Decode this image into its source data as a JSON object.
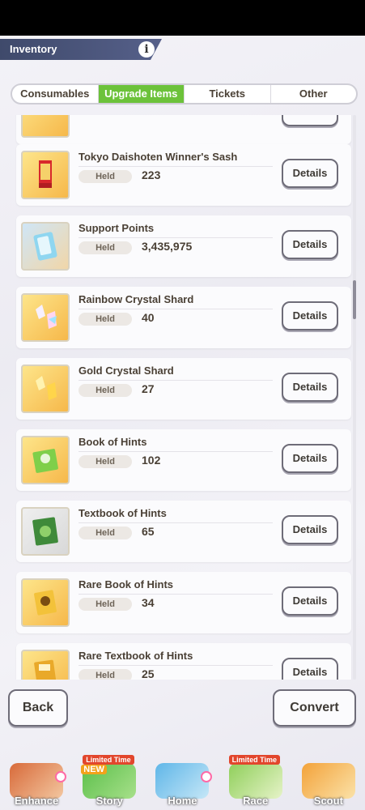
{
  "header": {
    "title": "Inventory",
    "info_glyph": "i"
  },
  "tabs": [
    {
      "label": "Consumables",
      "active": false
    },
    {
      "label": "Upgrade Items",
      "active": true
    },
    {
      "label": "Tickets",
      "active": false
    },
    {
      "label": "Other",
      "active": false
    }
  ],
  "items": [
    {
      "name": "Tokyo Daishoten Winner's Sash",
      "held_label": "Held",
      "count": "223",
      "details_label": "Details",
      "icon": "sash-icon"
    },
    {
      "name": "Support Points",
      "held_label": "Held",
      "count": "3,435,975",
      "details_label": "Details",
      "icon": "support-card-icon"
    },
    {
      "name": "Rainbow Crystal Shard",
      "held_label": "Held",
      "count": "40",
      "details_label": "Details",
      "icon": "rainbow-shard-icon"
    },
    {
      "name": "Gold Crystal Shard",
      "held_label": "Held",
      "count": "27",
      "details_label": "Details",
      "icon": "gold-shard-icon"
    },
    {
      "name": "Book of Hints",
      "held_label": "Held",
      "count": "102",
      "details_label": "Details",
      "icon": "book-of-hints-icon"
    },
    {
      "name": "Textbook of Hints",
      "held_label": "Held",
      "count": "65",
      "details_label": "Details",
      "icon": "textbook-of-hints-icon"
    },
    {
      "name": "Rare Book of Hints",
      "held_label": "Held",
      "count": "34",
      "details_label": "Details",
      "icon": "rare-book-icon"
    },
    {
      "name": "Rare Textbook of Hints",
      "held_label": "Held",
      "count": "25",
      "details_label": "Details",
      "icon": "rare-textbook-icon"
    }
  ],
  "footer": {
    "back_label": "Back",
    "convert_label": "Convert"
  },
  "nav": [
    {
      "label": "Enhance",
      "badge": ""
    },
    {
      "label": "Story",
      "badge": "Limited Time",
      "new": "NEW"
    },
    {
      "label": "Home",
      "badge": ""
    },
    {
      "label": "Race",
      "badge": "Limited Time"
    },
    {
      "label": "Scout",
      "badge": ""
    }
  ],
  "colors": {
    "accent": "#6cc23a",
    "header_bg": "#3f4a6b",
    "text": "#4a4035"
  }
}
